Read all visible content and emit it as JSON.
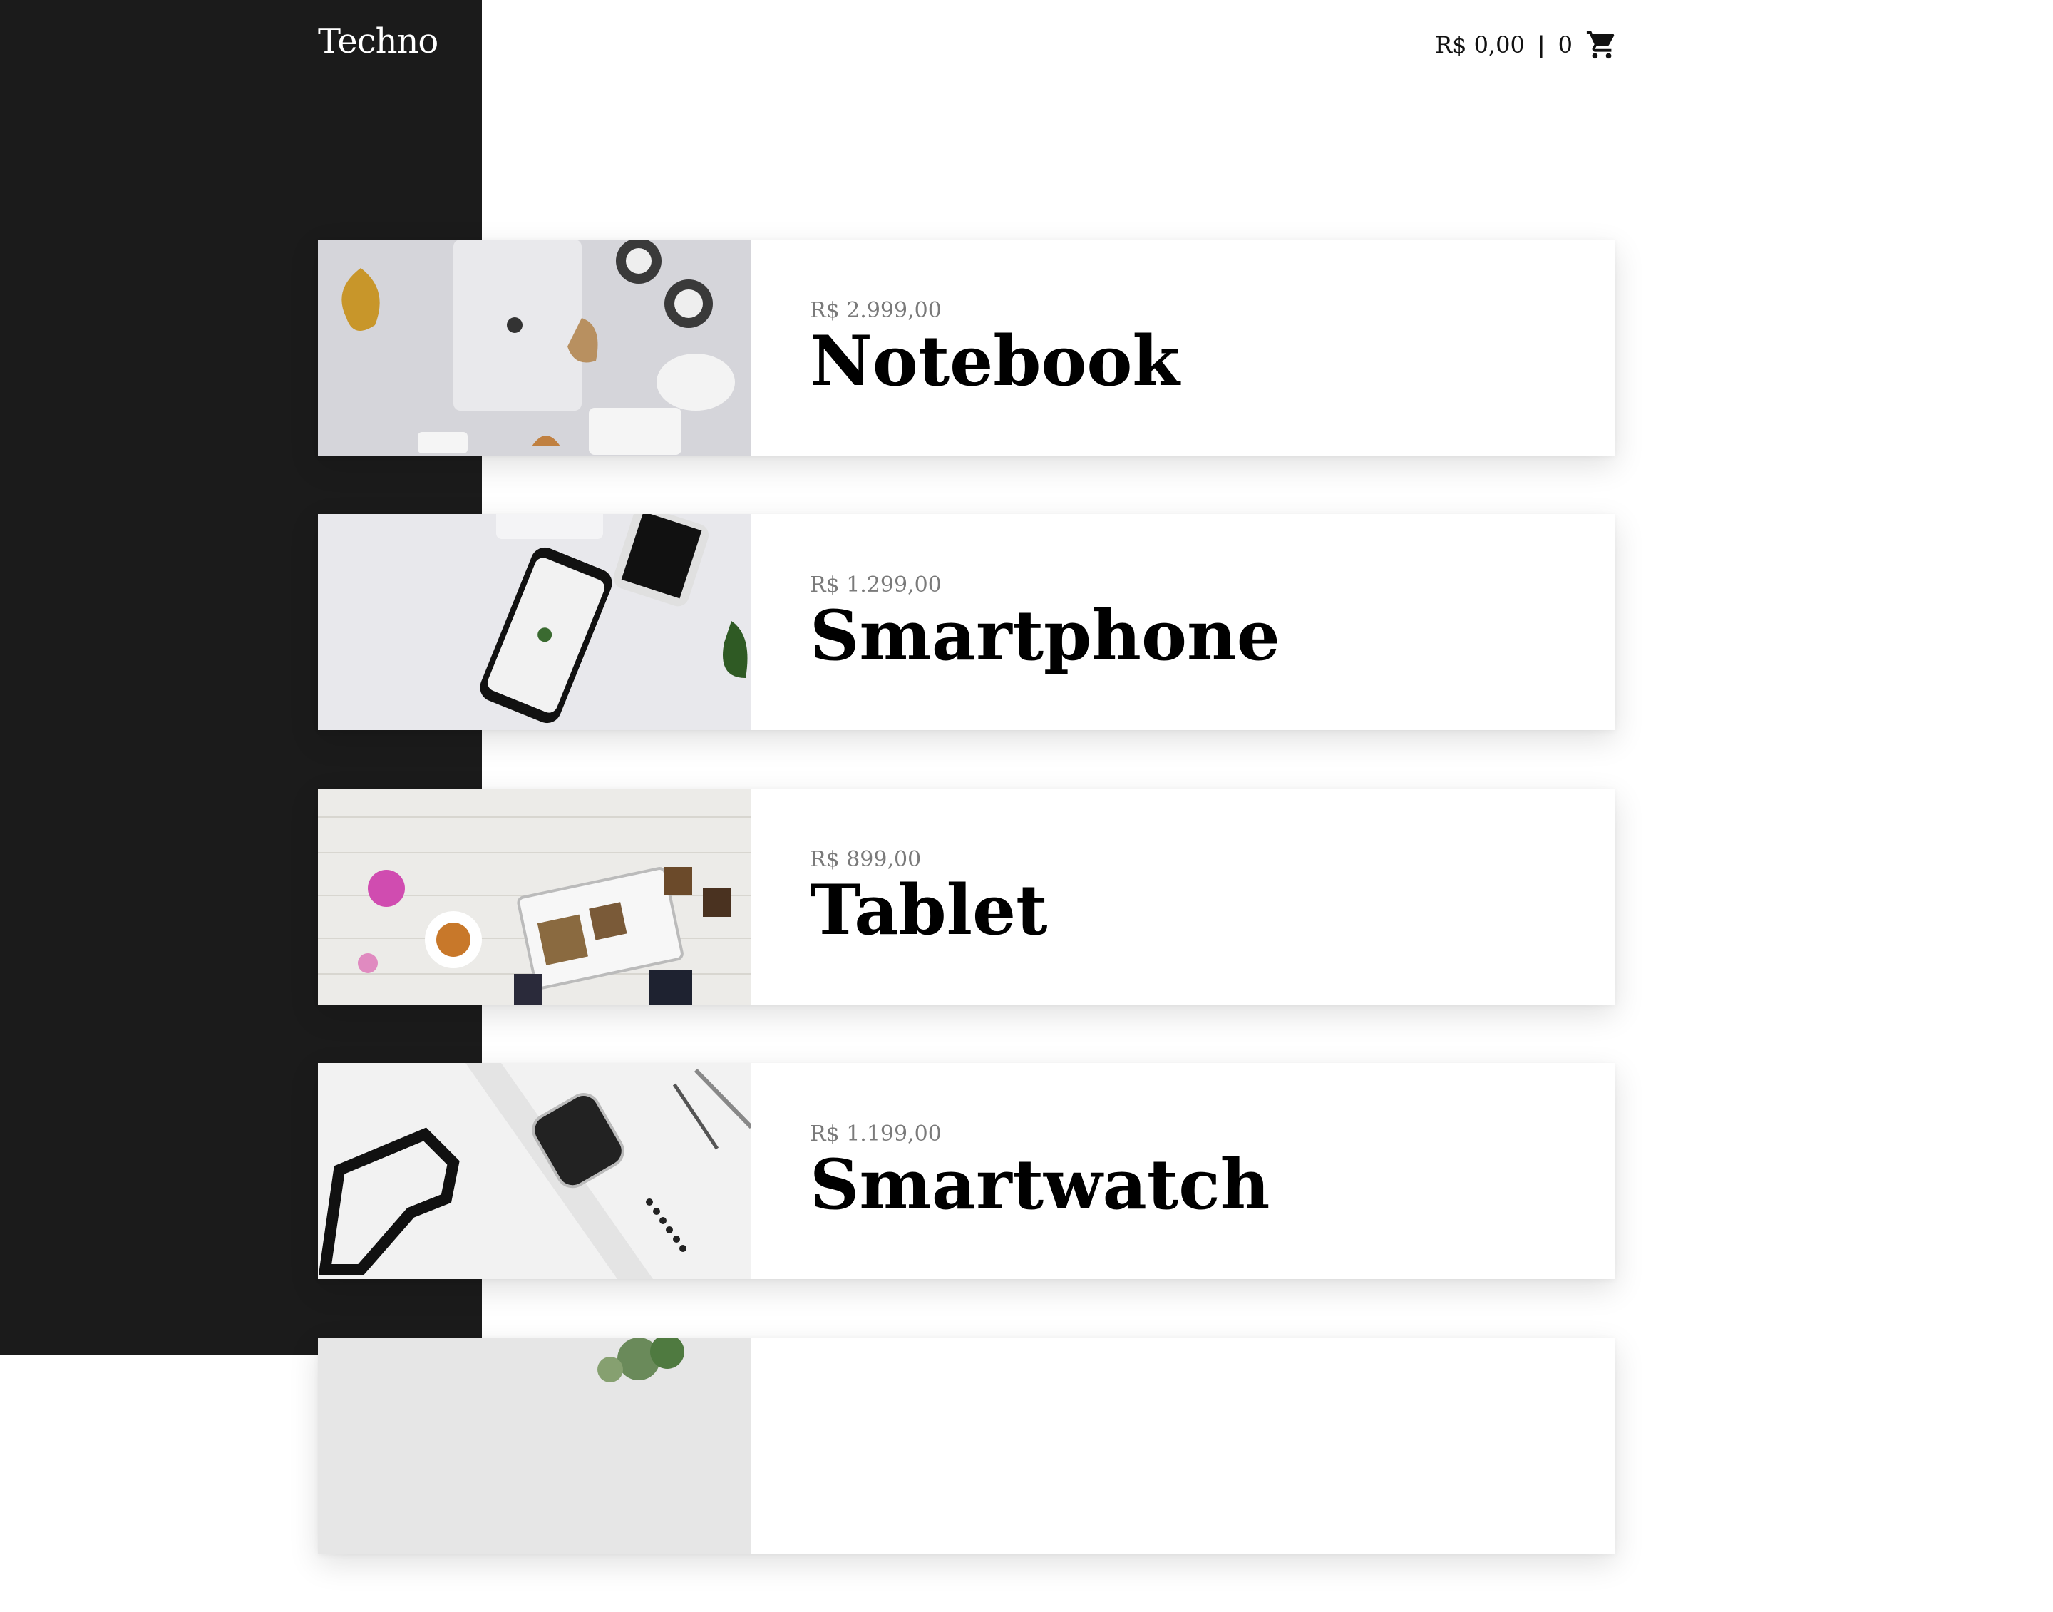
{
  "brand": {
    "name": "Techno"
  },
  "cart": {
    "total": "R$ 0,00",
    "separator": "|",
    "count": "0",
    "icon": "cart-icon"
  },
  "products": [
    {
      "price": "R$ 2.999,00",
      "name": "Notebook"
    },
    {
      "price": "R$ 1.299,00",
      "name": "Smartphone"
    },
    {
      "price": "R$ 899,00",
      "name": "Tablet"
    },
    {
      "price": "R$ 1.199,00",
      "name": "Smartwatch"
    },
    {
      "price": "",
      "name": ""
    }
  ],
  "colors": {
    "sidebar": "#1b1b1b",
    "price": "#7a7a7a",
    "text": "#000000"
  }
}
